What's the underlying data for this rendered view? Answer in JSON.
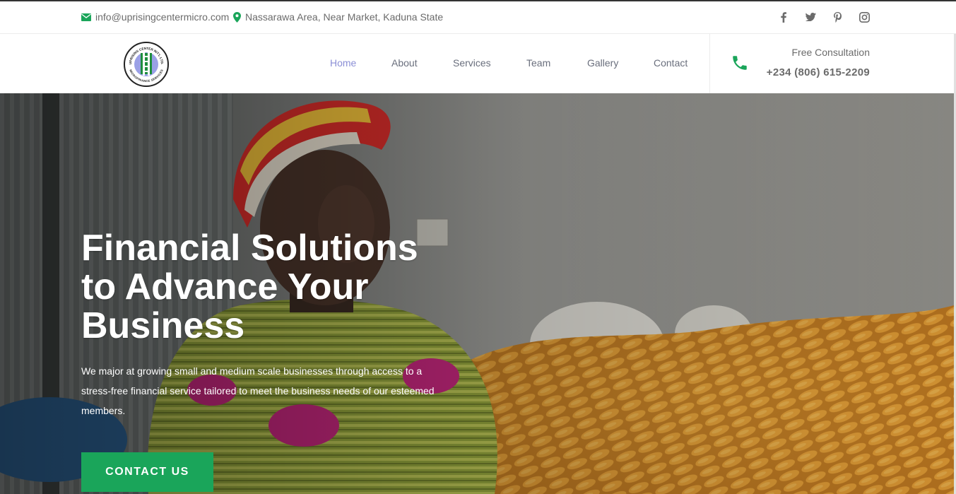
{
  "topbar": {
    "email": "info@uprisingcentermicro.com",
    "address": "Nassarawa Area, Near Market, Kaduna State",
    "social": [
      "facebook-icon",
      "twitter-icon",
      "pinterest-icon",
      "instagram-icon"
    ]
  },
  "logo": {
    "ring_text_top": "UPRISING CENTER INT'L LTD.",
    "ring_text_bottom": "MICROFINANCE SERVICES"
  },
  "nav": {
    "items": [
      {
        "label": "Home",
        "active": true
      },
      {
        "label": "About",
        "active": false
      },
      {
        "label": "Services",
        "active": false
      },
      {
        "label": "Team",
        "active": false
      },
      {
        "label": "Gallery",
        "active": false
      },
      {
        "label": "Contact",
        "active": false
      }
    ]
  },
  "consultation": {
    "label": "Free Consultation",
    "phone": "+234 (806) 615-2209"
  },
  "hero": {
    "title_line1": "Financial Solutions",
    "title_line2": "to Advance Your",
    "title_line3": "Business",
    "text": "We major at growing small and medium scale businesses through access to a stress-free financial service tailored to meet the business needs of our esteemed members.",
    "cta": "CONTACT US"
  },
  "colors": {
    "accent_green": "#1aa55a",
    "nav_active": "#8b8fd6",
    "nav_text": "#6a6f7d"
  }
}
